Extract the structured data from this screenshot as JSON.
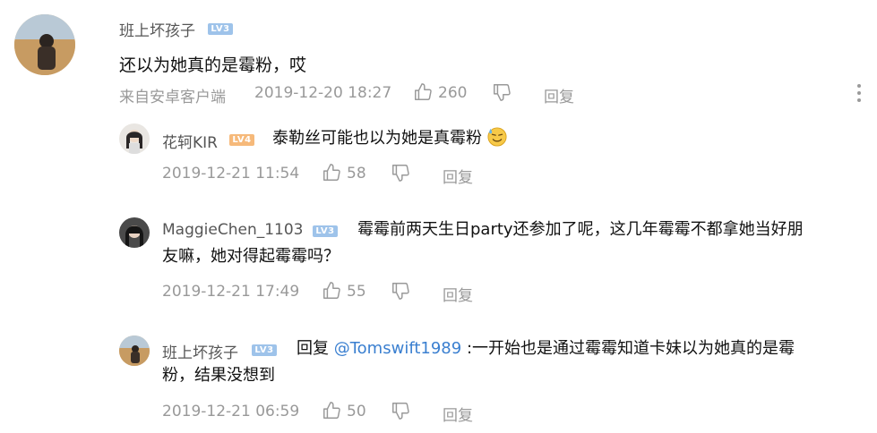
{
  "main_comment": {
    "username": "班上坏孩子",
    "level": "LV3",
    "text": "还以为她真的是霉粉，哎",
    "source": "来自安卓客户端",
    "time": "2019-12-20 18:27",
    "likes": "260",
    "reply_label": "回复"
  },
  "replies": [
    {
      "username": "花轲KIR",
      "level": "LV4",
      "text": "泰勒丝可能也以为她是真霉粉",
      "time": "2019-12-21 11:54",
      "likes": "58",
      "reply_label": "回复"
    },
    {
      "username": "MaggieChen_1103",
      "level": "LV3",
      "text_line1": "霉霉前两天生日party还参加了呢，这几年霉霉不都拿她当好朋",
      "text_line2": "友嘛，她对得起霉霉吗？",
      "time": "2019-12-21 17:49",
      "likes": "55",
      "reply_label": "回复"
    },
    {
      "username": "班上坏孩子",
      "level": "LV3",
      "reply_prefix": "回复",
      "mention": "@Tomswift1989",
      "text_line1": ":一开始也是通过霉霉知道卡妹以为她真的是霉",
      "text_line2": "粉，结果没想到",
      "time": "2019-12-21 06:59",
      "likes": "50",
      "reply_label": "回复"
    }
  ],
  "colors": {
    "badge_blue": "#9ec3ea",
    "badge_orange": "#f6b97a",
    "meta_gray": "#999999",
    "mention_blue": "#3a7fd0"
  },
  "icons": [
    "thumbs-up-icon",
    "thumbs-down-icon",
    "more-vertical-icon",
    "sweat-emoji-icon"
  ]
}
